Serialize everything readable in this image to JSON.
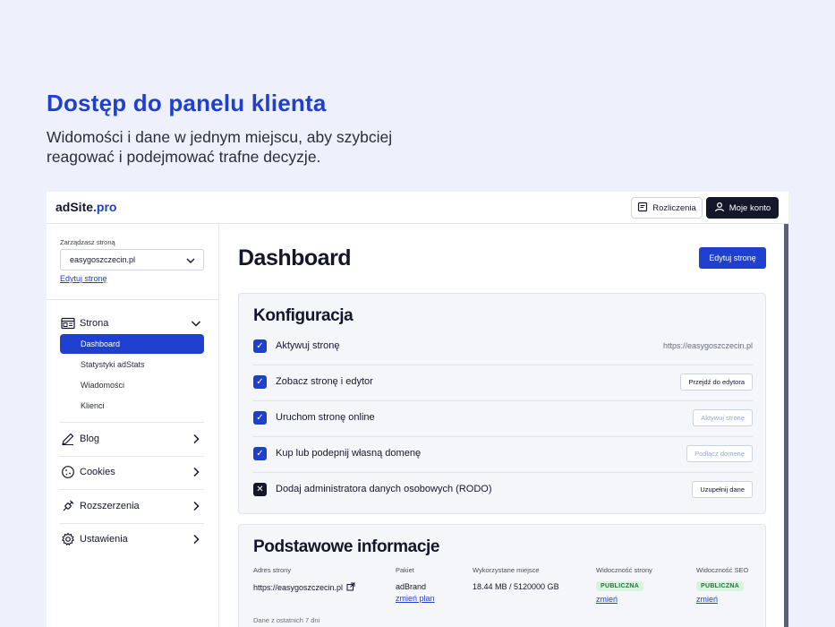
{
  "hero": {
    "title": "Dostęp do panelu klienta",
    "subtitle": "Widomości i dane w jednym miejscu, aby szybciej reagować i podejmować trafne decyzje."
  },
  "topbar": {
    "logo_main": "adSite",
    "logo_tld": ".pro",
    "billing_label": "Rozliczenia",
    "billing_icon": "receipt-icon",
    "account_label": "Moje konto",
    "account_icon": "user-icon"
  },
  "sidebar": {
    "manage_label": "Zarządzasz stroną",
    "selected_site": "easygoszczecin.pl",
    "edit_link": "Edytuj stronę",
    "page_section": {
      "label": "Strona",
      "icon": "page-icon",
      "items": [
        "Dashboard",
        "Statystyki adStats",
        "Wiadomości",
        "Klienci"
      ],
      "active_index": 0
    },
    "sections": [
      {
        "label": "Blog",
        "icon": "pen-icon"
      },
      {
        "label": "Cookies",
        "icon": "cookie-icon"
      },
      {
        "label": "Rozszerzenia",
        "icon": "plugin-icon"
      },
      {
        "label": "Ustawienia",
        "icon": "gear-icon"
      }
    ]
  },
  "main": {
    "title": "Dashboard",
    "edit_button": "Edytuj stronę",
    "config": {
      "title": "Konfiguracja",
      "rows": [
        {
          "label": "Aktywuj stronę",
          "done": true,
          "right_text": "https://easygoszczecin.pl",
          "right_type": "url"
        },
        {
          "label": "Zobacz stronę i edytor",
          "done": true,
          "right_text": "Przejdź do edytora",
          "right_type": "button"
        },
        {
          "label": "Uruchom stronę online",
          "done": true,
          "right_text": "Aktywuj stronę",
          "right_type": "button-muted"
        },
        {
          "label": "Kup lub podepnij własną domenę",
          "done": true,
          "right_text": "Podłącz domenę",
          "right_type": "button-muted"
        },
        {
          "label": "Dodaj administratora danych osobowych (RODO)",
          "done": false,
          "right_text": "Uzupełnij dane",
          "right_type": "button"
        }
      ]
    },
    "info": {
      "title": "Podstawowe informacje",
      "address_head": "Adres strony",
      "address_val": "https://easygoszczecin.pl",
      "package_head": "Pakiet",
      "package_val": "adBrand",
      "package_link": "zmień plan",
      "space_head": "Wykorzystane miejsce",
      "space_val": "18.44 MB / 5120000 GB",
      "visibility_head": "Widoczność strony",
      "visibility_badge": "PUBLICZNA",
      "visibility_link": "zmień",
      "seo_head": "Widoczność SEO",
      "seo_badge": "PUBLICZNA",
      "seo_link": "zmień",
      "footer_note": "Dane z ostatnich 7 dni"
    }
  },
  "colors": {
    "accent": "#1f3fcf",
    "dark": "#14162a",
    "background": "#eef1fb",
    "badge_green": "#d9f3df"
  }
}
